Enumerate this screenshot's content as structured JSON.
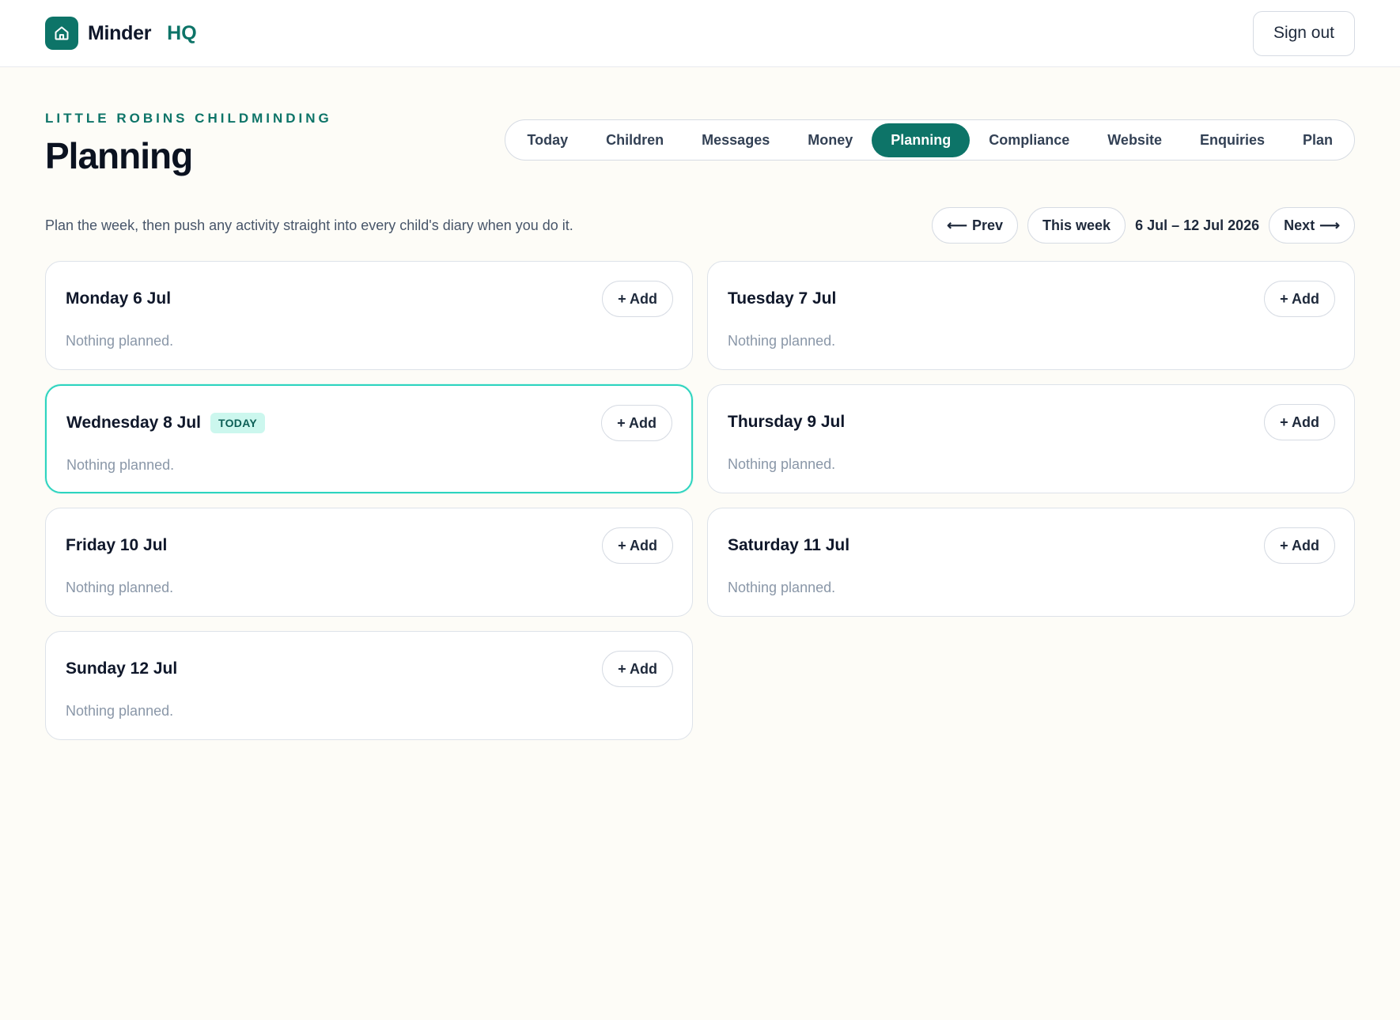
{
  "topbar": {
    "brand": "Minder",
    "brand_suffix": "HQ",
    "logo_icon": "home-icon",
    "sign_out": "Sign out"
  },
  "header": {
    "eyebrow": "LITTLE ROBINS CHILDMINDING",
    "title": "Planning"
  },
  "tabs": [
    {
      "label": "Today",
      "active": false
    },
    {
      "label": "Children",
      "active": false
    },
    {
      "label": "Messages",
      "active": false
    },
    {
      "label": "Money",
      "active": false
    },
    {
      "label": "Planning",
      "active": true
    },
    {
      "label": "Compliance",
      "active": false
    },
    {
      "label": "Website",
      "active": false
    },
    {
      "label": "Enquiries",
      "active": false
    },
    {
      "label": "Plan",
      "active": false
    }
  ],
  "subtitle": "Plan the week, then push any activity straight into every child's diary when you do it.",
  "weeknav": {
    "prev": "Prev",
    "this_week": "This week",
    "range": "6 Jul – 12 Jul 2026",
    "next": "Next"
  },
  "days": [
    {
      "title": "Monday 6 Jul",
      "today": false,
      "add": "+ Add",
      "empty": "Nothing planned."
    },
    {
      "title": "Tuesday 7 Jul",
      "today": false,
      "add": "+ Add",
      "empty": "Nothing planned."
    },
    {
      "title": "Wednesday 8 Jul",
      "today": true,
      "badge": "TODAY",
      "add": "+ Add",
      "empty": "Nothing planned."
    },
    {
      "title": "Thursday 9 Jul",
      "today": false,
      "add": "+ Add",
      "empty": "Nothing planned."
    },
    {
      "title": "Friday 10 Jul",
      "today": false,
      "add": "+ Add",
      "empty": "Nothing planned."
    },
    {
      "title": "Saturday 11 Jul",
      "today": false,
      "add": "+ Add",
      "empty": "Nothing planned."
    },
    {
      "title": "Sunday 12 Jul",
      "today": false,
      "add": "+ Add",
      "empty": "Nothing planned."
    }
  ],
  "colors": {
    "accent": "#0d7468",
    "today_border": "#2dd4bf",
    "background": "#fdfcf7"
  }
}
